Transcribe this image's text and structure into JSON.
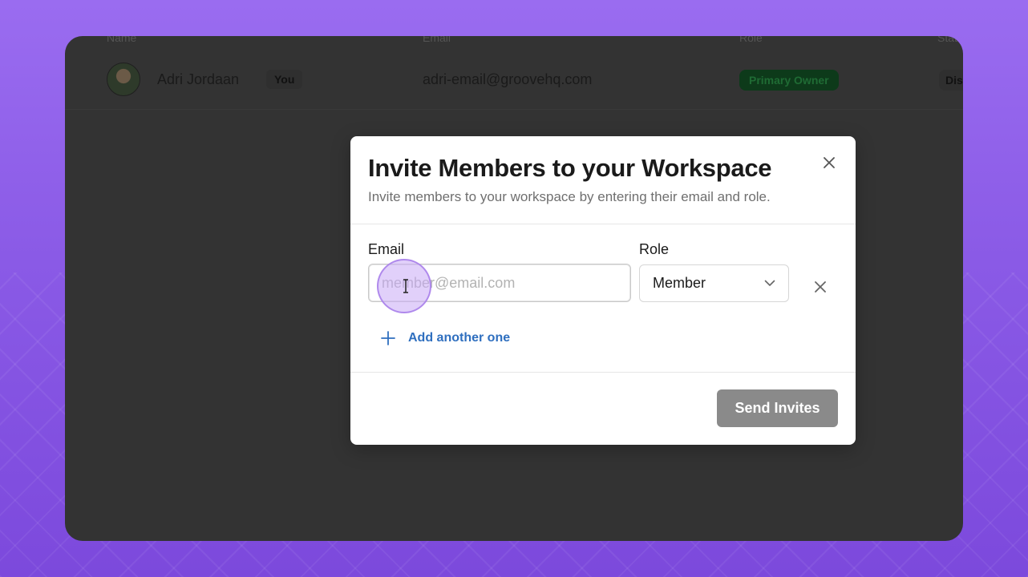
{
  "table": {
    "header": [
      "Name",
      "Email",
      "Role",
      "Status"
    ],
    "rows": [
      {
        "name": "Adri Jordaan",
        "you_badge": "You",
        "email": "adri-email@groovehq.com",
        "role": "Primary Owner",
        "action": "Disable"
      }
    ]
  },
  "modal": {
    "title": "Invite Members to your Workspace",
    "subtitle": "Invite members to your workspace by entering their email and role.",
    "email_label": "Email",
    "email_placeholder": "member@email.com",
    "email_value": "",
    "role_label": "Role",
    "role_value": "Member",
    "add_another_label": "Add another one",
    "send_label": "Send Invites"
  },
  "colors": {
    "background": "#8a5ae6",
    "app_surface": "#333333",
    "link": "#2f6fbf",
    "send_button_disabled": "#8a8a8a",
    "primary_owner_badge": "#0d3a1a"
  },
  "icons": {
    "close": "close-icon",
    "chevron": "chevron-down-icon",
    "remove": "close-icon",
    "add": "plus-icon",
    "cursor": "text-cursor-icon"
  }
}
